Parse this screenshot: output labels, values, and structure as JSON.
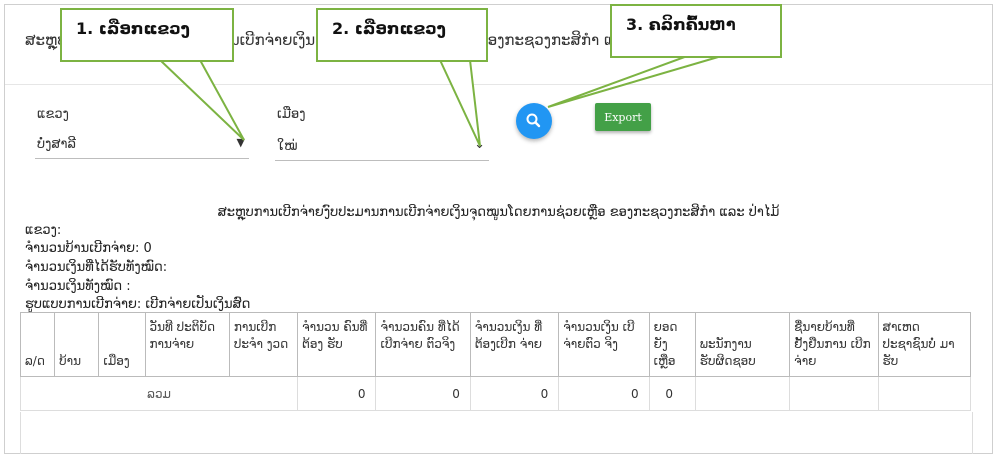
{
  "header": {
    "title": "ສະຫຼຸບການເບີກຈ່າຍງົບປະມານການເບີກຈ່າຍເງິນຈຸດໝູນໂດຍການຊ່ວຍເຫຼືອ ຂອງກະຊວງກະສິກຳ ແລະ ປ່າໄມ້"
  },
  "filters": {
    "province_label": "ແຂວງ",
    "province_value": "ບໍ່ງສາລີ",
    "district_label": "ເມືອງ",
    "district_value": "ໃໝ່"
  },
  "actions": {
    "export_label": "Export"
  },
  "callouts": {
    "step1": "1. ເລືອກແຂວງ",
    "step2": "2. ເລືອກແຂວງ",
    "step3": "3. ຄລິກຄົ້ນຫາ"
  },
  "report": {
    "title": "ສະຫຼຸບການເບີກຈ່າຍງົບປະມານການເບີກຈ່າຍເງິນຈຸດໝູນໂດຍການຊ່ວຍເຫຼືອ ຂອງກະຊວງກະສິກຳ ແລະ ປ່າໄມ້",
    "province_line": "ແຂວງ:",
    "villages_line": "ຈຳນວນບ້ານເບີກຈ່າຍ: 0",
    "received_line": "ຈຳນວນເງິນທີ່ໄດ້ຮັບທັງໝົດ:",
    "total_line": "ຈຳນວນເງິນທັງໝົດ :",
    "method_line": "ຮູບແບບການເບີກຈ່າຍ: ເບີກຈ່າຍເປັນເງິນສົດ"
  },
  "table": {
    "headers": [
      "ລ/ດ",
      "ບ້ານ",
      "ເມືອງ",
      "ວັນທີ ປະຕິບັດ ການຈ່າຍ",
      "ການເບີກ ປະຈຳ ງວດ",
      "ຈຳນວນ ຄົນທີ່ຕ້ອງ ຮັບ",
      "ຈຳນວນຄົນ ທີ່ໄດ້ເບີກຈ່າຍ ຕົວຈິງ",
      "ຈຳນວນເງິນ ທີ່ຕ້ອງເບີກ ຈ່າຍ",
      "ຈຳນວນເງິນ ເບີຈ່າຍຕົວ ຈິງ",
      "ຍອດ ຍັງ ເຫຼືອ",
      "ພະນັກງານ ຮັບຜິດຊອບ",
      "ຊື່ນາຍບ້ານທີ່ ຢັ້ງຢືນການ ເບີກຈ່າຍ",
      "ສາເຫດ ປະຊາຊົນບໍ່ ມາຮັບ"
    ],
    "total_label": "ລວມ",
    "totals": [
      "0",
      "0",
      "0",
      "0",
      "0"
    ]
  }
}
